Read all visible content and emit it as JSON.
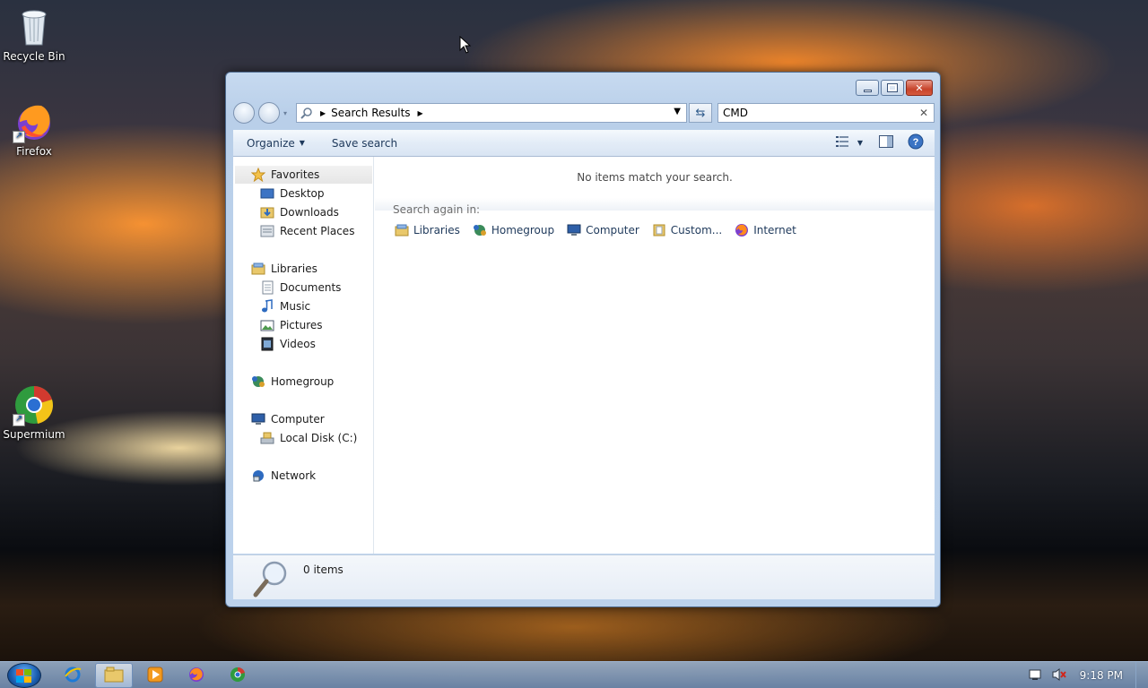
{
  "desktop": {
    "icons": [
      {
        "label": "Recycle Bin"
      },
      {
        "label": "Firefox"
      },
      {
        "label": "Supermium"
      }
    ]
  },
  "window": {
    "address": {
      "segment": "Search Results"
    },
    "search": {
      "value": "CMD"
    },
    "toolbar": {
      "organize_label": "Organize",
      "save_search_label": "Save search"
    },
    "nav": {
      "favorites": "Favorites",
      "desktop": "Desktop",
      "downloads": "Downloads",
      "recent_places": "Recent Places",
      "libraries": "Libraries",
      "documents": "Documents",
      "music": "Music",
      "pictures": "Pictures",
      "videos": "Videos",
      "homegroup": "Homegroup",
      "computer": "Computer",
      "local_disk": "Local Disk (C:)",
      "network": "Network"
    },
    "results": {
      "empty_message": "No items match your search.",
      "search_again_label": "Search again in:",
      "locations": {
        "libraries": "Libraries",
        "homegroup": "Homegroup",
        "computer": "Computer",
        "custom": "Custom...",
        "internet": "Internet"
      }
    },
    "details": {
      "count": "0 items"
    }
  },
  "taskbar": {
    "clock": "9:18 PM"
  }
}
